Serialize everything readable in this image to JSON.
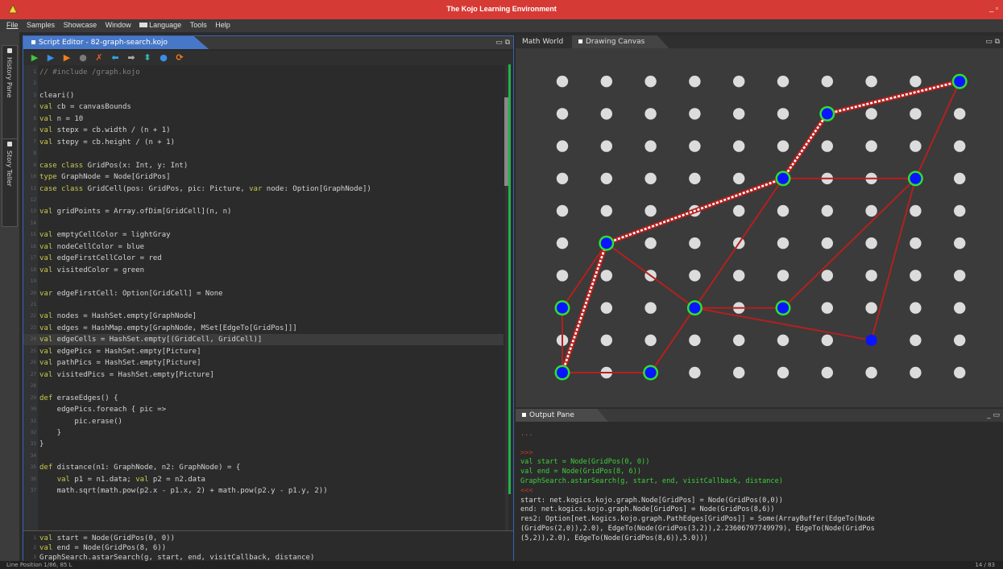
{
  "window": {
    "title": "The Kojo Learning Environment",
    "controls": "_ ▫"
  },
  "menu": [
    {
      "label": "File"
    },
    {
      "label": "Samples"
    },
    {
      "label": "Showcase"
    },
    {
      "label": "Window"
    },
    {
      "label": "Language"
    },
    {
      "label": "Tools"
    },
    {
      "label": "Help"
    }
  ],
  "sidebar": {
    "tabs": [
      {
        "label": "History Pane"
      },
      {
        "label": "Story Teller"
      }
    ]
  },
  "editor": {
    "tab_title": "Script Editor - 82-graph-search.kojo",
    "toolbar": [
      {
        "name": "run-button",
        "glyph": "▶",
        "color": "#3ec63e"
      },
      {
        "name": "run-worksheet-button",
        "glyph": "▶",
        "color": "#3a8ee6"
      },
      {
        "name": "trace-button",
        "glyph": "▶",
        "color": "#f07f1c"
      },
      {
        "name": "stop-button",
        "glyph": "●",
        "color": "#7a7a7a"
      },
      {
        "name": "check-button",
        "glyph": "✗",
        "color": "#e05a2b"
      },
      {
        "name": "previous-button",
        "glyph": "⬅",
        "color": "#35a3e6"
      },
      {
        "name": "next-button",
        "glyph": "➡",
        "color": "#aaaaaa"
      },
      {
        "name": "format-button",
        "glyph": "⬍",
        "color": "#33b3b3"
      },
      {
        "name": "clear-output-button",
        "glyph": "●",
        "color": "#3a8ee6"
      },
      {
        "name": "reset-button",
        "glyph": "⟳",
        "color": "#f07f1c"
      }
    ],
    "code": [
      {
        "n": "1",
        "t": "// #include /graph.kojo"
      },
      {
        "n": "2",
        "t": ""
      },
      {
        "n": "3",
        "t": "cleari()"
      },
      {
        "n": "4",
        "t": "val cb = canvasBounds"
      },
      {
        "n": "5",
        "t": "val n = 10"
      },
      {
        "n": "6",
        "t": "val stepx = cb.width / (n + 1)"
      },
      {
        "n": "7",
        "t": "val stepy = cb.height / (n + 1)"
      },
      {
        "n": "8",
        "t": ""
      },
      {
        "n": "9",
        "t": "case class GridPos(x: Int, y: Int)"
      },
      {
        "n": "10",
        "t": "type GraphNode = Node[GridPos]"
      },
      {
        "n": "11",
        "t": "case class GridCell(pos: GridPos, pic: Picture, var node: Option[GraphNode])"
      },
      {
        "n": "12",
        "t": ""
      },
      {
        "n": "13",
        "t": "val gridPoints = Array.ofDim[GridCell](n, n)"
      },
      {
        "n": "14",
        "t": ""
      },
      {
        "n": "15",
        "t": "val emptyCellColor = lightGray"
      },
      {
        "n": "16",
        "t": "val nodeCellColor = blue"
      },
      {
        "n": "17",
        "t": "val edgeFirstCellColor = red"
      },
      {
        "n": "18",
        "t": "val visitedColor = green"
      },
      {
        "n": "19",
        "t": ""
      },
      {
        "n": "20",
        "t": "var edgeFirstCell: Option[GridCell] = None"
      },
      {
        "n": "21",
        "t": ""
      },
      {
        "n": "22",
        "t": "val nodes = HashSet.empty[GraphNode]"
      },
      {
        "n": "23",
        "t": "val edges = HashMap.empty[GraphNode, MSet[EdgeTo[GridPos]]]"
      },
      {
        "n": "24",
        "t": "val edgeCells = HashSet.empty[(GridCell, GridCell)]"
      },
      {
        "n": "25",
        "t": "val edgePics = HashSet.empty[Picture]"
      },
      {
        "n": "26",
        "t": "val pathPics = HashSet.empty[Picture]"
      },
      {
        "n": "27",
        "t": "val visitedPics = HashSet.empty[Picture]"
      },
      {
        "n": "28",
        "t": ""
      },
      {
        "n": "29",
        "t": "def eraseEdges() {"
      },
      {
        "n": "30",
        "t": "    edgePics.foreach { pic =>"
      },
      {
        "n": "31",
        "t": "        pic.erase()"
      },
      {
        "n": "32",
        "t": "    }"
      },
      {
        "n": "33",
        "t": "}"
      },
      {
        "n": "34",
        "t": ""
      },
      {
        "n": "35",
        "t": "def distance(n1: GraphNode, n2: GraphNode) = {"
      },
      {
        "n": "36",
        "t": "    val p1 = n1.data; val p2 = n2.data"
      },
      {
        "n": "37",
        "t": "    math.sqrt(math.pow(p2.x - p1.x, 2) + math.pow(p2.y - p1.y, 2))"
      }
    ],
    "commands": [
      {
        "n": "1",
        "t": "val start = Node(GridPos(0, 0))"
      },
      {
        "n": "2",
        "t": "val end = Node(GridPos(8, 6))"
      },
      {
        "n": "3",
        "t": "GraphSearch.astarSearch(g, start, end, visitCallback, distance)"
      }
    ]
  },
  "canvas": {
    "tabs": [
      {
        "label": "Math World"
      },
      {
        "label": "Drawing Canvas"
      }
    ],
    "grid": {
      "cols": 10,
      "rows": 10
    },
    "dot_colors": {
      "empty": "#dcdcdc",
      "node": "#0a14ff",
      "visited_ring": "#2ee02e",
      "edge": "#b3201f",
      "path": "#ffffff"
    },
    "nodes": [
      {
        "c": 0,
        "r": 0,
        "visited": true
      },
      {
        "c": 2,
        "r": 0,
        "visited": true
      },
      {
        "c": 0,
        "r": 2,
        "visited": true
      },
      {
        "c": 3,
        "r": 2,
        "visited": true
      },
      {
        "c": 5,
        "r": 2,
        "visited": true
      },
      {
        "c": 7,
        "r": 1,
        "visited": false
      },
      {
        "c": 1,
        "r": 4,
        "visited": true
      },
      {
        "c": 5,
        "r": 6,
        "visited": true
      },
      {
        "c": 8,
        "r": 6,
        "visited": true
      },
      {
        "c": 6,
        "r": 8,
        "visited": true
      },
      {
        "c": 9,
        "r": 9,
        "visited": true
      }
    ],
    "edges": [
      [
        [
          0,
          0
        ],
        [
          2,
          0
        ]
      ],
      [
        [
          2,
          0
        ],
        [
          3,
          2
        ]
      ],
      [
        [
          0,
          0
        ],
        [
          0,
          2
        ]
      ],
      [
        [
          0,
          2
        ],
        [
          1,
          4
        ]
      ],
      [
        [
          1,
          4
        ],
        [
          3,
          2
        ]
      ],
      [
        [
          3,
          2
        ],
        [
          5,
          2
        ]
      ],
      [
        [
          3,
          2
        ],
        [
          7,
          1
        ]
      ],
      [
        [
          3,
          2
        ],
        [
          5,
          6
        ]
      ],
      [
        [
          5,
          2
        ],
        [
          8,
          6
        ]
      ],
      [
        [
          5,
          6
        ],
        [
          8,
          6
        ]
      ],
      [
        [
          8,
          6
        ],
        [
          9,
          9
        ]
      ],
      [
        [
          8,
          6
        ],
        [
          7,
          1
        ]
      ],
      [
        [
          1,
          4
        ],
        [
          5,
          6
        ]
      ],
      [
        [
          0,
          0
        ],
        [
          1,
          4
        ]
      ]
    ],
    "path": [
      [
        0,
        0
      ],
      [
        1,
        4
      ],
      [
        5,
        6
      ],
      [
        6,
        8
      ],
      [
        9,
        9
      ]
    ]
  },
  "output": {
    "tab_title": "Output Pane",
    "lines": [
      {
        "t": "...",
        "style": "dim"
      },
      {
        "t": "",
        "style": ""
      },
      {
        "t": ">>>",
        "style": "red"
      },
      {
        "t": "val start = Node(GridPos(0, 0))",
        "style": "green"
      },
      {
        "t": "val end = Node(GridPos(8, 6))",
        "style": "green"
      },
      {
        "t": "GraphSearch.astarSearch(g, start, end, visitCallback, distance)",
        "style": "green"
      },
      {
        "t": "<<<",
        "style": "red"
      },
      {
        "t": "start: net.kogics.kojo.graph.Node[GridPos] = Node(GridPos(0,0))",
        "style": ""
      },
      {
        "t": "end: net.kogics.kojo.graph.Node[GridPos] = Node(GridPos(8,6))",
        "style": ""
      },
      {
        "t": "res2: Option[net.kogics.kojo.graph.PathEdges[GridPos]] = Some(ArrayBuffer(EdgeTo(Node",
        "style": ""
      },
      {
        "t": "(GridPos(2,0)),2.0), EdgeTo(Node(GridPos(3,2)),2.23606797749979), EdgeTo(Node(GridPos",
        "style": ""
      },
      {
        "t": "(5,2)),2.0), EdgeTo(Node(GridPos(8,6)),5.0)))",
        "style": ""
      }
    ]
  },
  "status": {
    "left": "Line Position 1/86, 85 L",
    "right": "14 / 83"
  }
}
